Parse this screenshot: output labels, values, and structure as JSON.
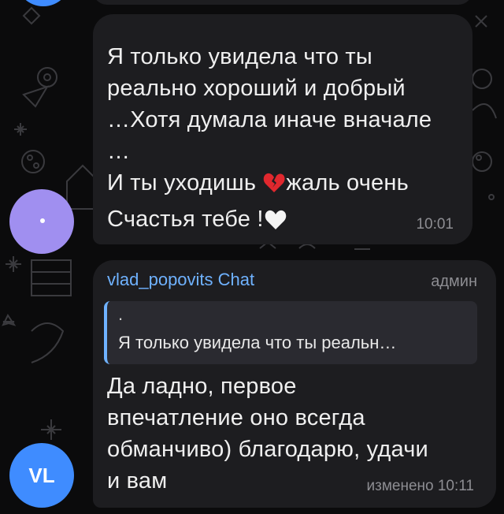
{
  "messages": [
    {
      "text_lines": [
        "Я только увидела что ты",
        "реально хороший и добрый",
        "…Хотя думала иначе вначале",
        "…",
        "И ты уходишь "
      ],
      "after_broken_heart": "жаль очень",
      "last_line": "Счастья тебе !",
      "prefix_mark": ".",
      "time": "10:01"
    },
    {
      "sender": "vlad_popovits Chat",
      "role": "админ",
      "reply_mark": ".",
      "reply_text": "Я только увидела что ты реальн…",
      "text": "Да ладно, первое\nвпечатление оно всегда\nобманчиво) благодарю, удачи\nи вам",
      "time": "изменено 10:11"
    }
  ],
  "avatars": {
    "second_initials": "VL"
  },
  "colors": {
    "background": "#0b0b0c",
    "bubble": "#1d1d20",
    "link_blue": "#6fb2ff",
    "avatar_purple": "#a08ff0",
    "avatar_blue": "#3f8cff"
  },
  "icons": {
    "broken_heart": "broken-heart-emoji",
    "white_heart": "white-heart-emoji"
  }
}
